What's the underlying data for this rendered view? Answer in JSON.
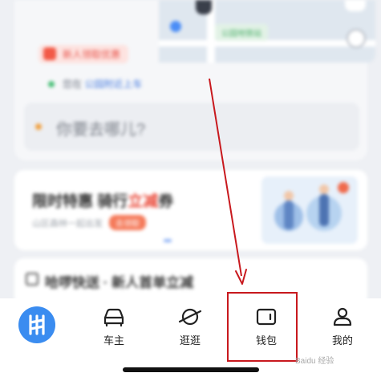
{
  "map": {
    "route_label": "公园地铁站",
    "promo_pill": "新人领取优惠",
    "start_prefix": "您在",
    "start_place": "公园附近上车"
  },
  "destination": {
    "placeholder": "你要去哪儿?"
  },
  "promo_card": {
    "title_main": "限时特惠 骑行",
    "title_highlight": "立减",
    "title_tail": "券",
    "subtitle": "山区森林一起出发",
    "tag": "去领取"
  },
  "news_card": {
    "title": "哈啰快送 · 新人首单立减"
  },
  "tabbar": {
    "tabs": [
      {
        "id": "home",
        "label": "",
        "icon": "hellobike-logo-icon"
      },
      {
        "id": "car_owner",
        "label": "车主",
        "icon": "car-icon"
      },
      {
        "id": "explore",
        "label": "逛逛",
        "icon": "planet-icon"
      },
      {
        "id": "wallet",
        "label": "钱包",
        "icon": "wallet-icon"
      },
      {
        "id": "mine",
        "label": "我的",
        "icon": "person-icon"
      }
    ]
  },
  "annotation": {
    "highlight_color": "#c8191e",
    "target": "wallet"
  },
  "watermark": "Baidu 经验"
}
